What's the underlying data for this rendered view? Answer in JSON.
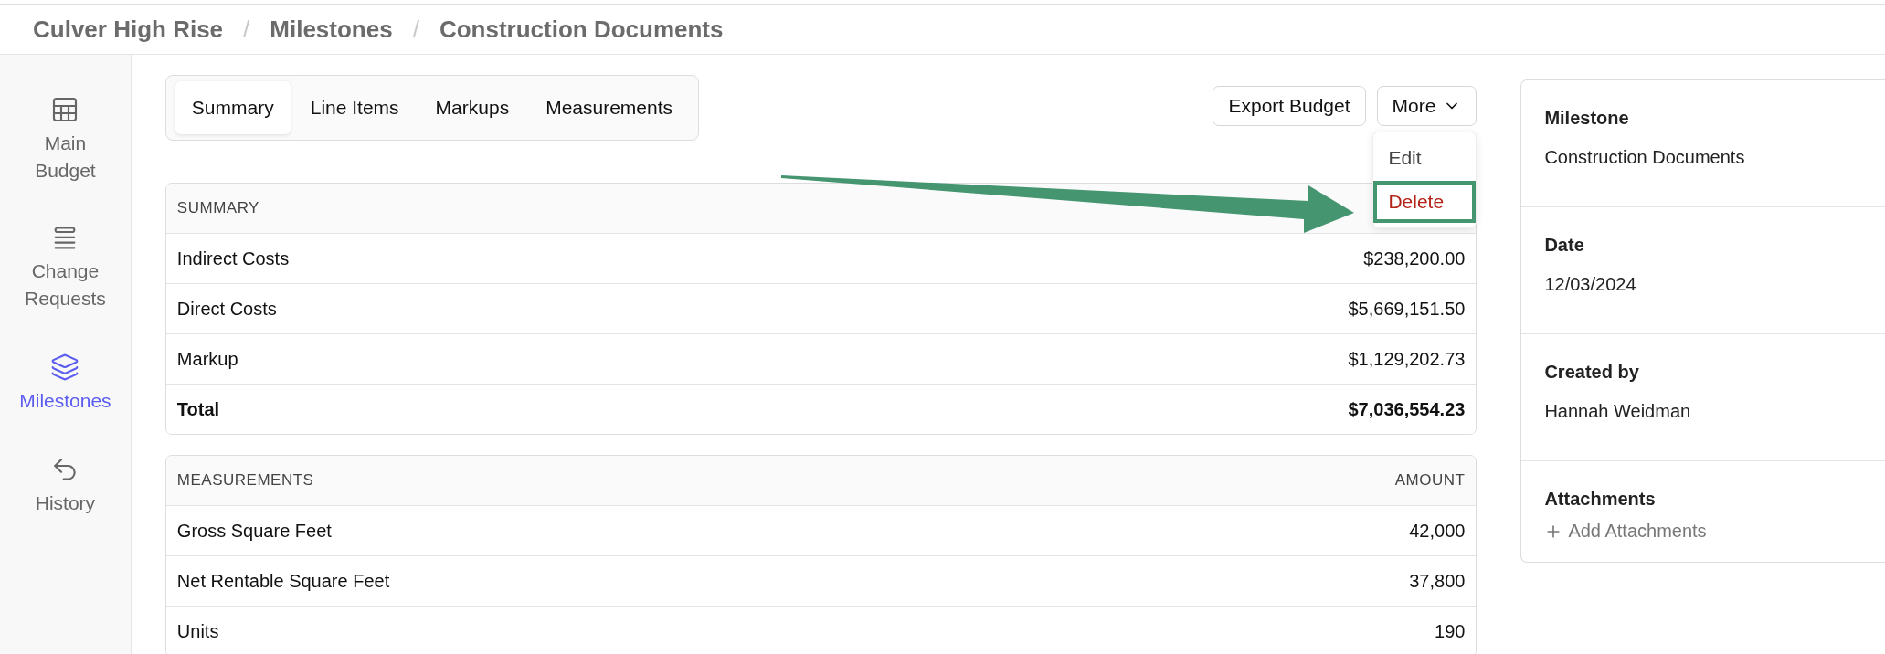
{
  "breadcrumb": {
    "separator": "/",
    "items": [
      "Culver High Rise",
      "Milestones",
      "Construction Documents"
    ]
  },
  "sidebar": {
    "items": [
      {
        "label": "Main Budget",
        "selected": false
      },
      {
        "label": "Change Requests",
        "selected": false
      },
      {
        "label": "Milestones",
        "selected": true
      },
      {
        "label": "History",
        "selected": false
      }
    ]
  },
  "tabs": [
    {
      "label": "Summary",
      "selected": true
    },
    {
      "label": "Line Items",
      "selected": false
    },
    {
      "label": "Markups",
      "selected": false
    },
    {
      "label": "Measurements",
      "selected": false
    }
  ],
  "actions": {
    "export_button": "Export Budget",
    "more_button": "More"
  },
  "more_menu": [
    {
      "label": "Edit",
      "kind": "normal",
      "highlighted": false
    },
    {
      "label": "Delete",
      "kind": "danger",
      "highlighted": true
    }
  ],
  "tables": [
    {
      "columns": [
        "SUMMARY"
      ],
      "rows": [
        {
          "label": "Indirect Costs",
          "amount": "$238,200.00",
          "bold": false
        },
        {
          "label": "Direct Costs",
          "amount": "$5,669,151.50",
          "bold": false
        },
        {
          "label": "Markup",
          "amount": "$1,129,202.73",
          "bold": false
        },
        {
          "label": "Total",
          "amount": "$7,036,554.23",
          "bold": true
        }
      ]
    },
    {
      "columns": [
        "MEASUREMENTS",
        "AMOUNT"
      ],
      "rows": [
        {
          "label": "Gross Square Feet",
          "amount": "42,000",
          "bold": false
        },
        {
          "label": "Net Rentable Square Feet",
          "amount": "37,800",
          "bold": false
        },
        {
          "label": "Units",
          "amount": "190",
          "bold": false
        }
      ]
    }
  ],
  "details": {
    "sections": [
      {
        "label": "Milestone",
        "value": "Construction Documents"
      },
      {
        "label": "Date",
        "value": "12/03/2024"
      },
      {
        "label": "Created by",
        "value": "Hannah Weidman"
      }
    ],
    "attachments": {
      "label": "Attachments",
      "action": "Add Attachments"
    }
  }
}
